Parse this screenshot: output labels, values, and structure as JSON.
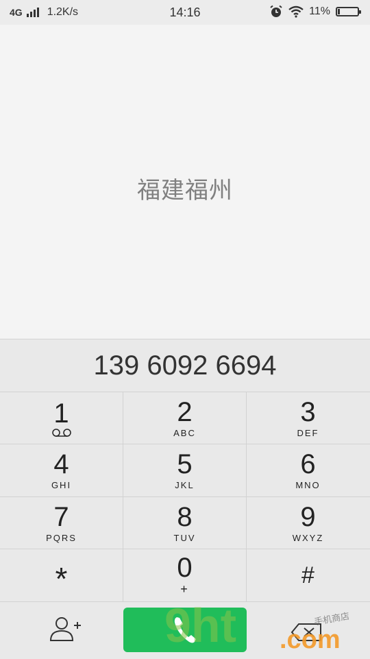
{
  "status_bar": {
    "network": "4G",
    "speed": "1.2K/s",
    "time": "14:16",
    "battery": "11%",
    "battery_level": 0.11,
    "icons": [
      "signal-icon",
      "alarm-icon",
      "wifi-icon",
      "battery-icon"
    ]
  },
  "location": "福建福州",
  "dialed_number": "139 6092 6694",
  "keys": [
    {
      "digit": "1",
      "sub": ""
    },
    {
      "digit": "2",
      "sub": "ABC"
    },
    {
      "digit": "3",
      "sub": "DEF"
    },
    {
      "digit": "4",
      "sub": "GHI"
    },
    {
      "digit": "5",
      "sub": "JKL"
    },
    {
      "digit": "6",
      "sub": "MNO"
    },
    {
      "digit": "7",
      "sub": "PQRS"
    },
    {
      "digit": "8",
      "sub": "TUV"
    },
    {
      "digit": "9",
      "sub": "WXYZ"
    },
    {
      "digit": "*",
      "sub": ""
    },
    {
      "digit": "0",
      "sub": "+"
    },
    {
      "digit": "#",
      "sub": ""
    }
  ],
  "bottom_icons": [
    "add-contact-icon",
    "phone-icon",
    "backspace-icon"
  ],
  "watermark": {
    "brand": "9ht",
    "domain": ".com",
    "text": "手机商店"
  },
  "colors": {
    "call_button": "#20bd5a",
    "background": "#f4f4f4",
    "keypad": "#e9e9e9"
  }
}
